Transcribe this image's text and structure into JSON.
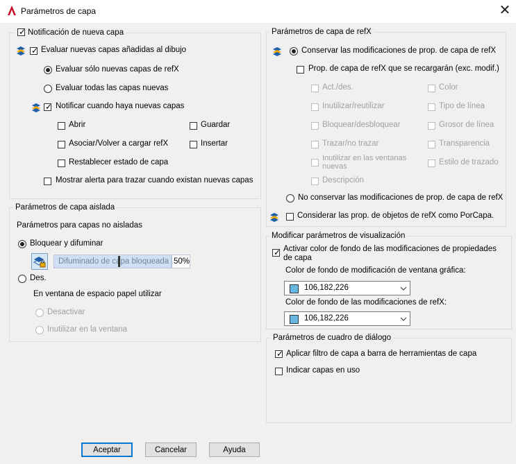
{
  "window": {
    "title": "Parámetros de capa",
    "close_glyph": "✕"
  },
  "new_layer": {
    "legend": "Notificación de nueva capa",
    "evaluate": "Evaluar nuevas capas añadidas al dibujo",
    "only_xref": "Evaluar sólo nuevas capas de refX",
    "all_new": "Evaluar todas las capas nuevas",
    "notify": "Notificar cuando haya nuevas capas",
    "open": "Abrir",
    "save": "Guardar",
    "attach": "Asociar/Volver a cargar refX",
    "insert": "Insertar",
    "restore": "Restablecer estado de capa",
    "alert": "Mostrar alerta para trazar cuando existan nuevas capas"
  },
  "isolate": {
    "legend": "Parámetros de capa aislada",
    "subtitle": "Parámetros para capas no aisladas",
    "lock_fade": "Bloquear y difuminar",
    "fade_text": "Difuminado de capa bloqueada",
    "fade_value": "50%",
    "off": "Des.",
    "paper_space": "En ventana de espacio papel utilizar",
    "deactivate": "Desactivar",
    "vp_freeze": "Inutilizar en la ventana"
  },
  "xref": {
    "legend": "Parámetros de capa de refX",
    "keep": "Conservar las modificaciones de prop. de capa de refX",
    "reload": "Prop. de capa de refX que se recargarán (exc. modif.)",
    "props_left": [
      "Act./des.",
      "Inutilizar/reutilizar",
      "Bloquear/desbloquear",
      "Trazar/no trazar",
      "Inutilizar en las ventanas nuevas",
      "Descripción"
    ],
    "props_right": [
      "Color",
      "Tipo de línea",
      "Grosor de línea",
      "Transparencia",
      "Estilo de trazado"
    ],
    "no_keep": "No conservar las modificaciones de prop. de capa de refX",
    "bylayer": "Considerar las prop. de objetos de refX como PorCapa."
  },
  "display": {
    "legend": "Modificar parámetros de visualización",
    "activate": "Activar color de fondo de las modificaciones de propiedades de capa",
    "vp_label": "Color de fondo de modificación de ventana gráfica:",
    "vp_color": "106,182,226",
    "xref_label": "Color de fondo de las modificaciones de refX:",
    "xref_color": "106,182,226",
    "color_hex": "#6ab6e2"
  },
  "dialog": {
    "legend": "Parámetros de cuadro de diálogo",
    "apply_filter": "Aplicar filtro de capa a barra de herramientas de capa",
    "indicate": "Indicar capas en uso"
  },
  "buttons": {
    "ok": "Aceptar",
    "cancel": "Cancelar",
    "help": "Ayuda"
  }
}
